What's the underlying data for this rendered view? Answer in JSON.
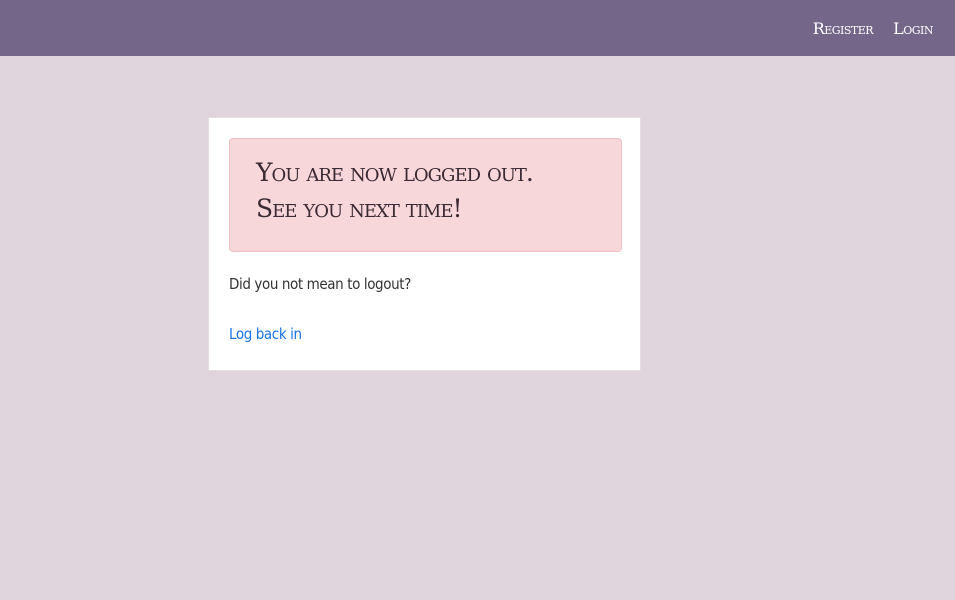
{
  "navbar": {
    "links": [
      {
        "label": "Register"
      },
      {
        "label": "Login"
      }
    ]
  },
  "card": {
    "alert": {
      "line1": "You are now logged out.",
      "line2": "See you next time!"
    },
    "question": "Did you not mean to logout?",
    "relogin_link": "Log back in"
  },
  "colors": {
    "navbar_bg": "#736689",
    "page_bg": "#e0d4dd",
    "alert_bg": "#f8d7da",
    "link": "#1a73e8"
  }
}
